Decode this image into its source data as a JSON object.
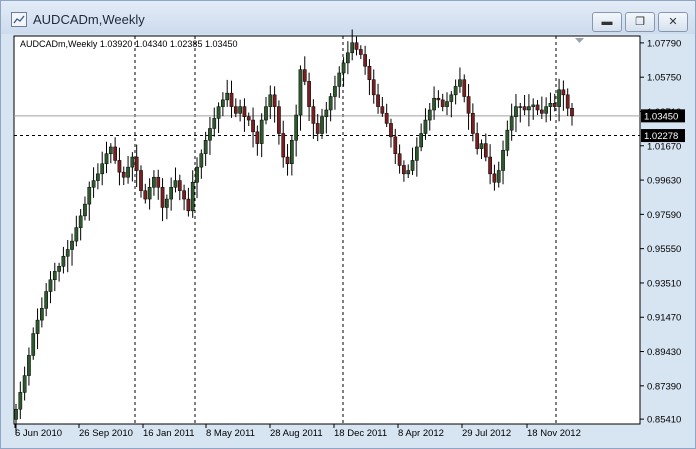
{
  "window": {
    "title": "AUDCADm,Weekly",
    "minimize_icon": "minimize-icon",
    "maximize_icon": "restore-icon",
    "close_icon": "close-icon"
  },
  "chart_data": {
    "type": "candlestick",
    "symbol": "AUDCADm",
    "timeframe": "Weekly",
    "ohlc_header": "AUDCADm,Weekly  1.03920 1.04340 1.02385 1.03450",
    "current_price": 1.0345,
    "current_price_label": "1.03450",
    "crosshair_price": 1.02278,
    "crosshair_price_label": "1.02278",
    "ylim": [
      0.8512,
      1.082
    ],
    "y_ticks": [
      "1.07790",
      "1.05750",
      "1.03710",
      "1.01670",
      "0.99630",
      "0.97590",
      "0.95550",
      "0.93510",
      "0.91470",
      "0.89430",
      "0.87390",
      "0.85410"
    ],
    "x_ticks": [
      "6 Jun 2010",
      "26 Sep 2010",
      "16 Jan 2011",
      "8 May 2011",
      "28 Aug 2011",
      "18 Dec 2011",
      "8 Apr 2012",
      "29 Jul 2012",
      "18 Nov 2012"
    ],
    "period_separators": [
      "26 Sep 2010",
      "16 Jan 2011",
      "18 Dec 2011",
      "18 Nov 2012"
    ],
    "bull_color": "#2d5a2d",
    "bear_color": "#7a1f1f",
    "close_path": [
      0.86,
      0.87,
      0.88,
      0.892,
      0.905,
      0.913,
      0.92,
      0.93,
      0.937,
      0.942,
      0.945,
      0.951,
      0.955,
      0.96,
      0.968,
      0.975,
      0.982,
      0.992,
      0.996,
      1.0,
      1.006,
      1.012,
      1.016,
      1.008,
      1.001,
      0.998,
      1.004,
      1.01,
      1.002,
      0.99,
      0.985,
      0.992,
      0.998,
      0.992,
      0.98,
      0.985,
      0.992,
      0.996,
      0.99,
      0.985,
      0.978,
      0.995,
      1.004,
      1.012,
      1.02,
      1.027,
      1.033,
      1.04,
      1.044,
      1.048,
      1.04,
      1.036,
      1.04,
      1.034,
      1.032,
      1.025,
      1.018,
      1.032,
      1.04,
      1.047,
      1.04,
      1.024,
      1.01,
      1.006,
      1.02,
      1.035,
      1.062,
      1.055,
      1.04,
      1.03,
      1.024,
      1.034,
      1.038,
      1.046,
      1.052,
      1.06,
      1.066,
      1.072,
      1.078,
      1.074,
      1.071,
      1.064,
      1.056,
      1.047,
      1.04,
      1.036,
      1.03,
      1.022,
      1.012,
      1.005,
      1.0,
      1.002,
      1.008,
      1.016,
      1.024,
      1.032,
      1.038,
      1.045,
      1.044,
      1.04,
      1.043,
      1.047,
      1.052,
      1.056,
      1.046,
      1.036,
      1.024,
      1.015,
      1.018,
      1.01,
      1.0,
      0.995,
      1.002,
      1.014,
      1.026,
      1.034,
      1.04,
      1.04,
      1.038,
      1.04,
      1.041,
      1.038,
      1.036,
      1.04,
      1.042,
      1.04,
      1.05,
      1.047,
      1.039,
      1.0345
    ]
  }
}
